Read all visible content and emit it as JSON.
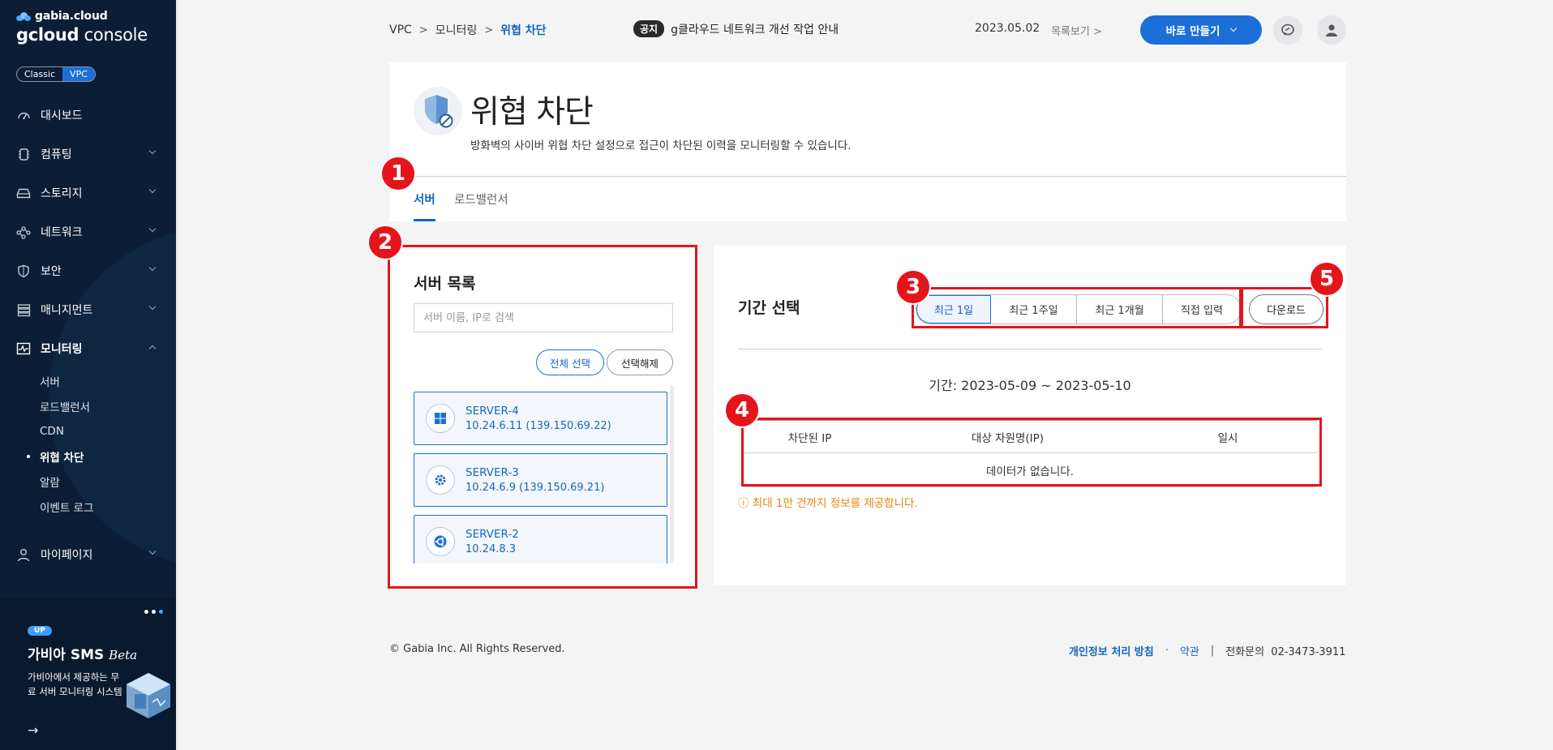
{
  "brand": {
    "top": "gabia.cloud",
    "main_a": "gcloud",
    "main_b": " console"
  },
  "switch": {
    "classic": "Classic",
    "vpc": "VPC"
  },
  "nav": {
    "items": [
      {
        "label": "대시보드",
        "icon": "dashboard-icon"
      },
      {
        "label": "컴퓨팅",
        "icon": "chip-icon"
      },
      {
        "label": "스토리지",
        "icon": "storage-icon"
      },
      {
        "label": "네트워크",
        "icon": "network-icon"
      },
      {
        "label": "보안",
        "icon": "shield-icon"
      },
      {
        "label": "매니지먼트",
        "icon": "management-icon"
      },
      {
        "label": "모니터링",
        "icon": "monitor-icon"
      }
    ],
    "sub": [
      "서버",
      "로드밸런서",
      "CDN",
      "위협 차단",
      "알람",
      "이벤트 로그"
    ],
    "mypage": "마이페이지"
  },
  "promo": {
    "badge": "UP",
    "title": "가비아 SMS",
    "title_suffix": "Beta",
    "desc": "가비아에서 제공하는 무료 서버 모니터링 시스템",
    "arrow": "→"
  },
  "breadcrumb": {
    "root": "VPC",
    "sep": ">",
    "mid": "모니터링",
    "current": "위협 차단"
  },
  "notice": {
    "tag": "공지",
    "text": "g클라우드 네트워크 개선 작업 안내",
    "date": "2023.05.02",
    "list": "목록보기 >"
  },
  "header": {
    "create_button": "바로 만들기"
  },
  "page": {
    "title": "위협 차단",
    "desc": "방화벽의 사이버 위협 차단 설정으로 접근이 차단된 이력을 모니터링할 수 있습니다.",
    "tabs": [
      "서버",
      "로드밸런서"
    ]
  },
  "server_panel": {
    "title": "서버 목록",
    "search_placeholder": "서버 이름, IP로 검색",
    "select_all": "전체 선택",
    "deselect": "선택해제",
    "servers": [
      {
        "name": "SERVER-4",
        "ip": "10.24.6.11 (139.150.69.22)",
        "os_icon": "windows-icon"
      },
      {
        "name": "SERVER-3",
        "ip": "10.24.6.9 (139.150.69.21)",
        "os_icon": "gear-os-icon"
      },
      {
        "name": "SERVER-2",
        "ip": "10.24.8.3",
        "os_icon": "ubuntu-icon"
      }
    ]
  },
  "period_panel": {
    "title": "기간 선택",
    "options": [
      "최근 1일",
      "최근 1주일",
      "최근 1개월",
      "직접 입력"
    ],
    "selected": "최근 1일",
    "download": "다운로드",
    "range": "기간: 2023-05-09 ~ 2023-05-10",
    "table": {
      "headers": [
        "차단된 IP",
        "대상 자원명(IP)",
        "일시"
      ],
      "empty": "데이터가 없습니다."
    },
    "warning": "ⓘ 최대 1만 건까지 정보를 제공합니다."
  },
  "annotations": [
    "1",
    "2",
    "3",
    "4",
    "5"
  ],
  "footer": {
    "copyright": "© Gabia Inc. All Rights Reserved.",
    "privacy": "개인정보 처리 방침",
    "dot": "·",
    "terms": "약관",
    "bar": "|",
    "tel_label": "전화문의",
    "tel": "02-3473-3911"
  },
  "colors": {
    "accent": "#1c6fd8",
    "annotation": "#e5141b",
    "sidebar": "#0c1e35",
    "warning": "#e8820c"
  }
}
